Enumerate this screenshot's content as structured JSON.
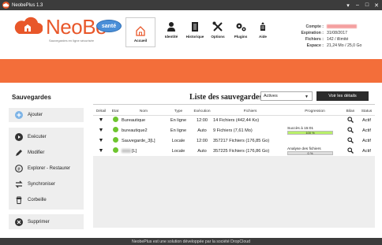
{
  "window": {
    "title": "NeobePlus 1.3",
    "app_icon": "neobe-app-icon",
    "controls": [
      "▾",
      "–",
      "□",
      "✕"
    ]
  },
  "logo": {
    "brand": "NeoBe",
    "tagline": "Sauvegardes en ligne sécurisée",
    "badge": "santé"
  },
  "nav": [
    {
      "label": "Accueil",
      "icon": "home-icon"
    },
    {
      "label": "Identité",
      "icon": "user-icon"
    },
    {
      "label": "Historique",
      "icon": "document-icon"
    },
    {
      "label": "Options",
      "icon": "tools-icon"
    },
    {
      "label": "Plugins",
      "icon": "gears-icon"
    },
    {
      "label": "Aide",
      "icon": "help-icon"
    }
  ],
  "account": [
    {
      "key": "Compte :",
      "value": ""
    },
    {
      "key": "Expiration :",
      "value": "31/08/2017"
    },
    {
      "key": "Fichiers :",
      "value": "142 / illimité"
    },
    {
      "key": "Espace :",
      "value": "21,24 Mo / 25,0 Go"
    }
  ],
  "sidebar": {
    "title": "Sauvegardes",
    "add_label": "Ajouter",
    "items": [
      {
        "label": "Exécuter",
        "icon": "play-icon"
      },
      {
        "label": "Modifier",
        "icon": "pencil-icon"
      },
      {
        "label": "Explorer - Restaurer",
        "icon": "explore-icon"
      },
      {
        "label": "Synchroniser",
        "icon": "sync-icon"
      },
      {
        "label": "Corbeille",
        "icon": "trash-icon"
      }
    ],
    "delete_label": "Supprimer"
  },
  "main": {
    "title": "Liste des sauvegardes",
    "filter_value": "Actives",
    "details_button": "Voir les détails",
    "columns": [
      "Détail",
      "Etat",
      "Nom",
      "Type",
      "Exécution",
      "Fichiers",
      "Progression",
      "Bilan",
      "Status"
    ],
    "rows": [
      {
        "name": "Bureautique",
        "type": "En ligne",
        "exec": "12:00",
        "files": "14 Fichiers (442,44 Ko)",
        "progress_text": "",
        "progress_value": null,
        "progress_label": "",
        "status": "Actif"
      },
      {
        "name": "bureautique2",
        "type": "En ligne",
        "exec": "Auto",
        "files": "9 Fichiers (7,61 Mo)",
        "progress_text": "Succès à 15:01",
        "progress_value": 100,
        "progress_label": "100 %",
        "status": "Actif"
      },
      {
        "name": "Sauvegarde_3[L]",
        "type": "Locale",
        "exec": "12:00",
        "files": "357217 Fichiers (176,85 Go)",
        "progress_text": "",
        "progress_value": null,
        "progress_label": "",
        "status": "Actif"
      },
      {
        "name": "[L]",
        "type": "Locale",
        "exec": "Auto",
        "files": "357225 Fichiers (176,86 Go)",
        "progress_text": "Analyse des fichiers",
        "progress_value": 0,
        "progress_label": "0 %",
        "status": "Actif"
      }
    ]
  },
  "footer": "NeobePlus est une solution développée par la société DropCloud",
  "colors": {
    "accent": "#f36e3a",
    "status_ok": "#6ec52f",
    "progress": "#b8ef6a",
    "dark": "#3c3c3c"
  }
}
